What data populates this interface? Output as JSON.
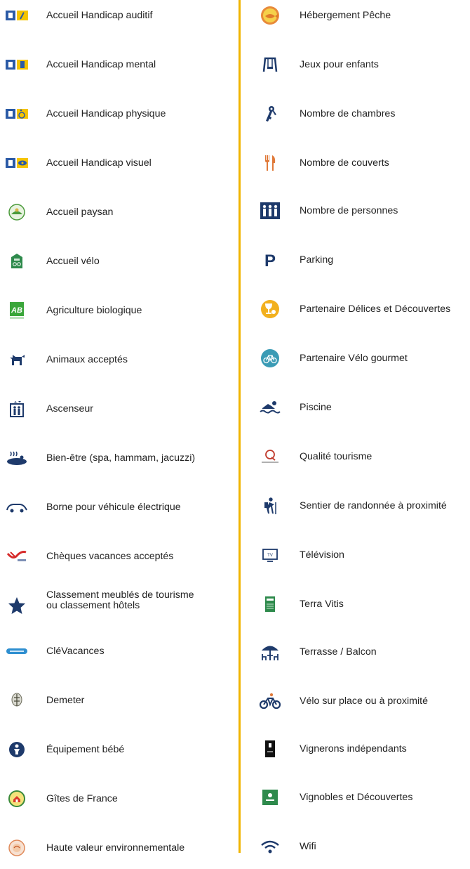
{
  "legend": {
    "left": [
      {
        "label": "Accueil Handicap auditif",
        "icon": "hearing-impaired-icon"
      },
      {
        "label": "Accueil Handicap mental",
        "icon": "mental-disability-icon"
      },
      {
        "label": "Accueil Handicap physique",
        "icon": "wheelchair-icon"
      },
      {
        "label": "Accueil Handicap visuel",
        "icon": "visual-impaired-icon"
      },
      {
        "label": "Accueil paysan",
        "icon": "accueil-paysan-icon"
      },
      {
        "label": "Accueil vélo",
        "icon": "accueil-velo-icon"
      },
      {
        "label": "Agriculture biologique",
        "icon": "ab-organic-icon"
      },
      {
        "label": "Animaux acceptés",
        "icon": "dog-icon"
      },
      {
        "label": "Ascenseur",
        "icon": "elevator-icon"
      },
      {
        "label": "Bien-être (spa, hammam, jacuzzi)",
        "icon": "spa-icon"
      },
      {
        "label": "Borne pour véhicule électrique",
        "icon": "electric-car-icon"
      },
      {
        "label": "Chèques vacances acceptés",
        "icon": "cheque-vacances-icon"
      },
      {
        "label": "Classement meublés de tourisme",
        "label2": "ou classement hôtels",
        "icon": "star-icon"
      },
      {
        "label": "CléVacances",
        "icon": "clevacances-icon"
      },
      {
        "label": "Demeter",
        "icon": "demeter-icon"
      },
      {
        "label": "Équipement bébé",
        "icon": "baby-icon"
      },
      {
        "label": "Gîtes de France",
        "icon": "gites-de-france-icon"
      },
      {
        "label": "Haute valeur environnementale",
        "icon": "hve-icon"
      }
    ],
    "right": [
      {
        "label": "Hébergement  Pêche",
        "icon": "fishing-icon"
      },
      {
        "label": "Jeux pour enfants",
        "icon": "swing-icon"
      },
      {
        "label": "Nombre de chambres",
        "icon": "keys-icon"
      },
      {
        "label": "Nombre de couverts",
        "icon": "cutlery-icon"
      },
      {
        "label": "Nombre de personnes",
        "icon": "people-icon"
      },
      {
        "label": "Parking",
        "icon": "parking-icon"
      },
      {
        "label": "Partenaire Délices et Découvertes",
        "icon": "wine-glass-icon"
      },
      {
        "label": "Partenaire Vélo gourmet",
        "icon": "bike-circle-icon"
      },
      {
        "label": "Piscine",
        "icon": "swimming-icon"
      },
      {
        "label": "Qualité tourisme",
        "icon": "qualite-tourisme-icon"
      },
      {
        "label": "Sentier de randonnée à proximité",
        "icon": "hiker-icon"
      },
      {
        "label": "Télévision",
        "icon": "tv-icon"
      },
      {
        "label": "Terra Vitis",
        "icon": "terra-vitis-icon"
      },
      {
        "label": "Terrasse / Balcon",
        "icon": "terrace-icon"
      },
      {
        "label": "Vélo sur place ou à proximité",
        "icon": "bicycle-icon"
      },
      {
        "label": "Vignerons indépendants",
        "icon": "vignerons-icon"
      },
      {
        "label": "Vignobles et Découvertes",
        "icon": "vignobles-icon"
      },
      {
        "label": "Wifi",
        "icon": "wifi-icon"
      }
    ],
    "tv_icon_text": "TV",
    "ab_icon_text": "AB",
    "parking_icon_text": "P"
  }
}
